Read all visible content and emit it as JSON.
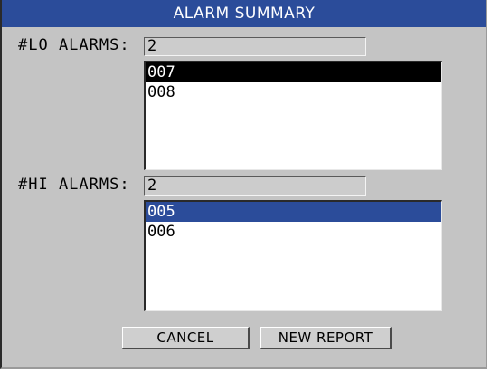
{
  "dialog": {
    "title": "ALARM SUMMARY"
  },
  "lo": {
    "label": "#LO ALARMS:",
    "count": "2",
    "items": [
      "007",
      "008"
    ],
    "selected_color": "#000000"
  },
  "hi": {
    "label": "#HI ALARMS:",
    "count": "2",
    "items": [
      "005",
      "006"
    ],
    "selected_color": "#2b4c9a"
  },
  "buttons": {
    "cancel": "CANCEL",
    "new_report": "NEW REPORT"
  },
  "colors": {
    "title_bar": "#2b4c9a",
    "background": "#c4c4c4"
  }
}
